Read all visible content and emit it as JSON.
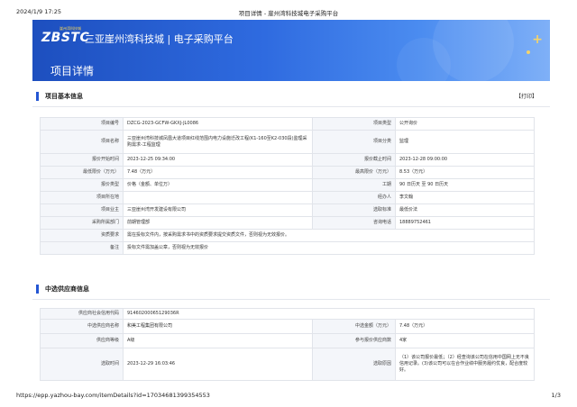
{
  "print_header": {
    "date": "2024/1/9 17:25",
    "title": "项目详情 - 崖州湾科技城电子采购平台"
  },
  "banner": {
    "logo_mark": "ZBSTC",
    "logo_tagline": "崖州湾科技城",
    "platform_name": "三亚崖州湾科技城 | 电子采购平台",
    "page_heading": "项目详情"
  },
  "basic_section": {
    "title": "项目基本信息",
    "print_label": "【打印】",
    "rows": [
      {
        "k1": "项目编号",
        "v1": "DZCG-2023-GCFW-GKXJ-JL0086",
        "k2": "项目类型",
        "v2": "公开询价"
      },
      {
        "k1": "项目名称",
        "v1": "三亚崖州湾科技城凤凰大道项目红线范围内电力设施迁改工程(K1-160至K2-030段)监理采购需求-工程监理",
        "k2": "项目分类",
        "v2": "监理"
      },
      {
        "k1": "报价开始时间",
        "v1": "2023-12-25 09:34:00",
        "k2": "报价截止时间",
        "v2": "2023-12-28 09:00:00"
      },
      {
        "k1": "最低限价（万元）",
        "v1": "7.48（万元）",
        "k2": "最高限价（万元）",
        "v2": "8.53（万元）"
      },
      {
        "k1": "报价类型",
        "v1": "价格（金额、单位万）",
        "k2": "工期",
        "v2": "90 日历天 至 90 日历天"
      },
      {
        "k1": "项目所在地",
        "v1": "",
        "k2": "经办人",
        "v2": "李文翰"
      },
      {
        "k1": "项目业主",
        "v1": "三亚崖州湾开发建设有限公司",
        "k2": "选取标准",
        "v2": "最低价法"
      },
      {
        "k1": "采购所属部门",
        "v1": "前期管理部",
        "k2": "咨询电话",
        "v2": "18889752461"
      },
      {
        "k1": "资质要求",
        "v1": "需在投标文件内，按采购需求书中的资质要求提交资质文件，否则视为无效报价。",
        "k2": "",
        "v2": ""
      },
      {
        "k1": "备注",
        "v1": "投标文件需加盖公章，否则视为无效报价",
        "k2": "",
        "v2": ""
      }
    ]
  },
  "winner_section": {
    "title": "中选供应商信息",
    "rows": [
      {
        "k1": "供应商社会信用代码",
        "v1": "91460200065129036R",
        "k2": "",
        "v2": ""
      },
      {
        "k1": "中选供应商名称",
        "v1": "和美工程集团有限公司",
        "k2": "中选金额（万元）",
        "v2": "7.48（万元）"
      },
      {
        "k1": "供应商等级",
        "v1": "A级",
        "k2": "参与报价供应商数",
        "v2": "4家"
      },
      {
        "k1": "选取时间",
        "v1": "2023-12-29 16:03:46",
        "k2": "选取原因",
        "v2": "（1）该公司报价最低；（2）经查询该公司在信用中国网上无不良信用记录。(3)该公司可以在合作业绩中服务履约优良，配合度较好。"
      }
    ]
  },
  "print_footer": {
    "url": "https://epp.yazhou-bay.com/itemDetails?id=17034681399354553",
    "page": "1/3"
  }
}
